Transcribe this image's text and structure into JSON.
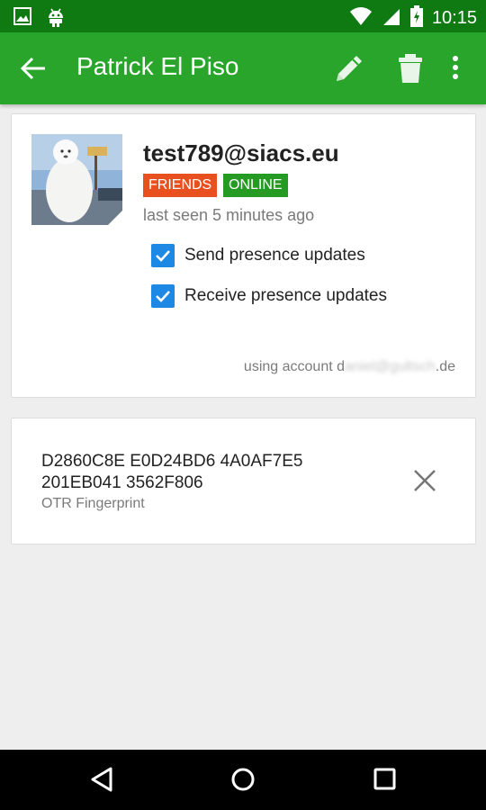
{
  "status_bar": {
    "time": "10:15",
    "icons": [
      "image-icon",
      "android-icon",
      "wifi-icon",
      "signal-icon",
      "battery-icon"
    ]
  },
  "toolbar": {
    "title": "Patrick El Piso",
    "icons": [
      "back-arrow-icon",
      "edit-pencil-icon",
      "trash-icon",
      "overflow-menu-icon"
    ]
  },
  "contact": {
    "jid": "test789@siacs.eu",
    "tags": [
      "FRIENDS",
      "ONLINE"
    ],
    "last_seen": "last seen 5 minutes ago",
    "send_presence": "Send presence updates",
    "receive_presence": "Receive presence updates",
    "account_prefix": "using account d",
    "account_hidden": "aniel@gultsch",
    "account_suffix": ".de"
  },
  "fingerprint": {
    "line1": "D2860C8E E0D24BD6 4A0AF7E5",
    "line2": "201EB041 3562F806",
    "label": "OTR Fingerprint"
  },
  "colors": {
    "toolbar": "#28a52a",
    "status_bar": "#0f7a12",
    "friends_tag": "#e8511f",
    "online_tag": "#259b24",
    "checkbox": "#1e88e5"
  }
}
